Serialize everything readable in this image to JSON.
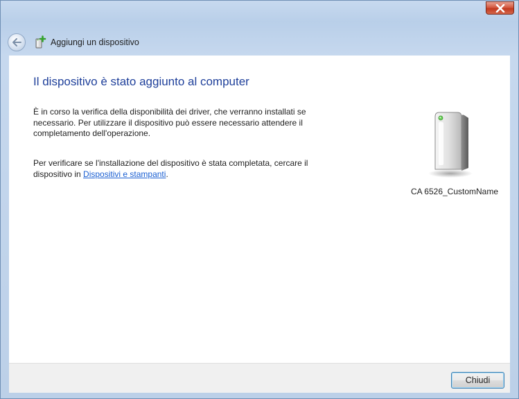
{
  "window": {
    "title": "Aggiungi un dispositivo"
  },
  "content": {
    "heading": "Il dispositivo è stato aggiunto al computer",
    "paragraph1": "È in corso la verifica della disponibilità dei driver, che verranno installati se necessario. Per utilizzare il dispositivo può essere necessario attendere il completamento dell'operazione.",
    "paragraph2_prefix": "Per verificare se l'installazione del dispositivo è stata completata, cercare il dispositivo in ",
    "paragraph2_link": "Dispositivi e stampanti",
    "paragraph2_suffix": "."
  },
  "device": {
    "name": "CA 6526_CustomName",
    "icon": "device-tower-icon"
  },
  "footer": {
    "close_label": "Chiudi"
  },
  "colors": {
    "heading": "#1e3f9a",
    "link": "#1a5fd2",
    "close_button": "#c23a1f"
  }
}
